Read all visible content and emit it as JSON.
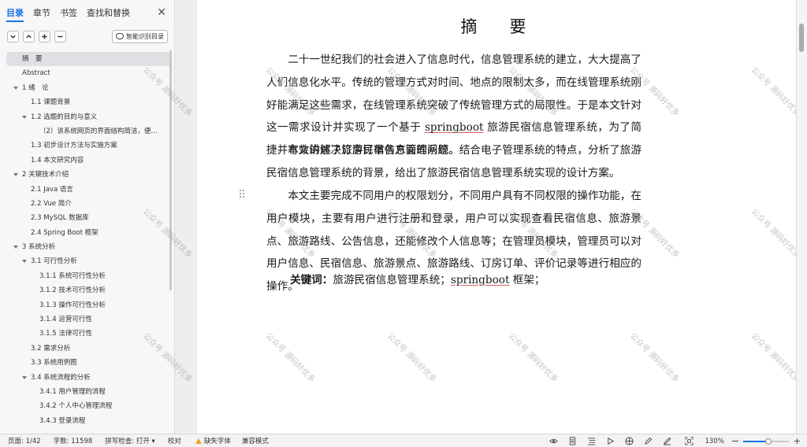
{
  "nav": {
    "tabs": [
      "目录",
      "章节",
      "书签",
      "查找和替换"
    ],
    "active_tab": 0,
    "close_icon": "close-icon",
    "tools": [
      "collapse-icon",
      "expand-icon",
      "add-icon",
      "remove-icon"
    ],
    "smart_button": "智能识别目录",
    "toc": [
      {
        "text": "摘　要",
        "level": 0,
        "arrow": false,
        "selected": true
      },
      {
        "text": "Abstract",
        "level": 0,
        "arrow": false
      },
      {
        "text": "1 绪　论",
        "level": 0,
        "arrow": true
      },
      {
        "text": "1.1  课题背景",
        "level": 1,
        "arrow": false
      },
      {
        "text": "1.2  选题的目的与意义",
        "level": 1,
        "arrow": true
      },
      {
        "text": "（2）该系统网页的界面结构简洁，便…",
        "level": 2,
        "arrow": false
      },
      {
        "text": "1.3  初步设计方法与实施方案",
        "level": 1,
        "arrow": false
      },
      {
        "text": "1.4  本文研究内容",
        "level": 1,
        "arrow": false
      },
      {
        "text": "2  关键技术介绍",
        "level": 0,
        "arrow": true
      },
      {
        "text": "2.1 Java 语言",
        "level": 1,
        "arrow": false
      },
      {
        "text": "2.2 Vue 简介",
        "level": 1,
        "arrow": false
      },
      {
        "text": "2.3    MySQL 数据库",
        "level": 1,
        "arrow": false
      },
      {
        "text": "2.4 Spring Boot 框架",
        "level": 1,
        "arrow": false
      },
      {
        "text": "3  系统分析",
        "level": 0,
        "arrow": true
      },
      {
        "text": "3.1 可行性分析",
        "level": 1,
        "arrow": true
      },
      {
        "text": "3.1.1 系统可行性分析",
        "level": 2,
        "arrow": false
      },
      {
        "text": "3.1.2    技术可行性分析",
        "level": 2,
        "arrow": false
      },
      {
        "text": "3.1.3  操作可行性分析",
        "level": 2,
        "arrow": false
      },
      {
        "text": "3.1.4 运营可行性",
        "level": 2,
        "arrow": false
      },
      {
        "text": "3.1.5 法律可行性",
        "level": 2,
        "arrow": false
      },
      {
        "text": "3.2  需求分析",
        "level": 1,
        "arrow": false
      },
      {
        "text": "3.3 系统用例图",
        "level": 1,
        "arrow": false
      },
      {
        "text": "3.4 系统流程的分析",
        "level": 1,
        "arrow": true
      },
      {
        "text": "3.4.1  用户管理的流程",
        "level": 2,
        "arrow": false
      },
      {
        "text": "3.4.2  个人中心管理流程",
        "level": 2,
        "arrow": false
      },
      {
        "text": "3.4.3  登录流程",
        "level": 2,
        "arrow": false
      }
    ]
  },
  "document": {
    "title": "摘　要",
    "p1_a": "二十一世纪我们的社会进入了信息时代，信息管理系统的建立，大大提高了人们信息化水平。传统的管理方式对时间、地点的限制太多，而在线管理系统刚好能满足这些需求，在线管理系统突破了传统管理方式的局限性。于是本文针对这一需求设计并实现了一个基于 ",
    "p1_term": "springboot",
    "p1_b": " 旅游民宿信息管理系统，为了简捷并有效的解决订房订单各方面的问题。",
    "p2": "本文讲述了旅游民宿信息管理系统。结合电子管理系统的特点，分析了旅游民宿信息管理系统的背景，给出了旅游民宿信息管理系统实现的设计方案。",
    "p3": "本文主要完成不同用户的权限划分，不同用户具有不同权限的操作功能，在用户模块，主要有用户进行注册和登录，用户可以实现查看民宿信息、旅游景点、旅游路线、公告信息，还能修改个人信息等；在管理员模块，管理员可以对用户信息、民宿信息、旅游景点、旅游路线、订房订单、评价记录等进行相应的操作。",
    "kw_label": "关键词：",
    "kw_a": "旅游民宿信息管理系统；",
    "kw_term": "springboot",
    "kw_b": " 框架；",
    "watermark": "公众号 源码好优多"
  },
  "status": {
    "page": "页面: 1/42",
    "words": "字数: 11598",
    "spell": "拼写检查: 打开 ▾",
    "proof": "校对",
    "missing_font": "缺失字体",
    "compat": "兼容模式",
    "zoom": "130%",
    "zoom_level": 0.55,
    "icons": [
      "eye-icon",
      "page-view-icon",
      "outline-view-icon",
      "play-icon",
      "web-view-icon",
      "edit-icon",
      "pen-icon",
      "fit-page-icon"
    ]
  }
}
